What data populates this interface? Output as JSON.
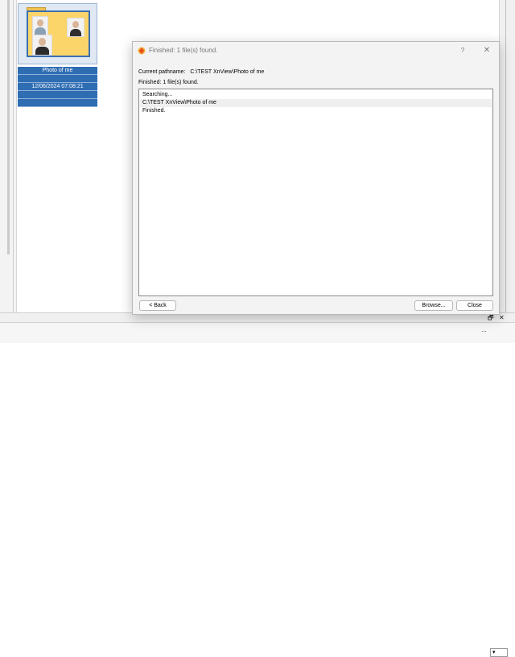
{
  "browser": {
    "thumbnail": {
      "name": "Photo of me",
      "date": "12/06/2024 07:08:21"
    }
  },
  "bottom_bar": {
    "restore_glyph": "🗗",
    "close_glyph": "✕",
    "more_glyph": "...",
    "dropdown_glyph": "▾"
  },
  "dialog": {
    "title": "Finished: 1 file(s) found.",
    "help_glyph": "?",
    "close_glyph": "✕",
    "current_pathname_label": "Current pathname:",
    "current_pathname_value": "C:\\TEST XnView\\Photo of me",
    "status": "Finished: 1 file(s) found.",
    "results": [
      "Searching...",
      "C:\\TEST XnView\\Photo of me",
      "Finished."
    ],
    "buttons": {
      "back": "< Back",
      "browse": "Browse...",
      "close": "Close"
    },
    "accent_color": "#e8531f"
  }
}
